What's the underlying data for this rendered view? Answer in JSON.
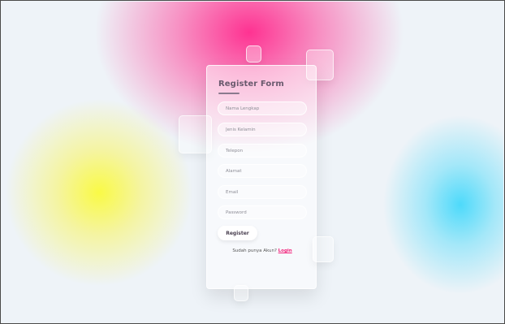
{
  "form": {
    "title": "Register Form",
    "fields": [
      {
        "placeholder": "Nama Lengkap"
      },
      {
        "placeholder": "Jenis Kelamin"
      },
      {
        "placeholder": "Telepon"
      },
      {
        "placeholder": "Alamat"
      },
      {
        "placeholder": "Email"
      },
      {
        "placeholder": "Password"
      }
    ],
    "submit_label": "Register",
    "footer_text": "Sudah punya Akun?",
    "login_link": "Login"
  },
  "colors": {
    "pink_blob": "#ff2a8c",
    "yellow_blob": "#f8f83c",
    "cyan_blob": "#3cd7fa",
    "link": "#f2217a"
  }
}
